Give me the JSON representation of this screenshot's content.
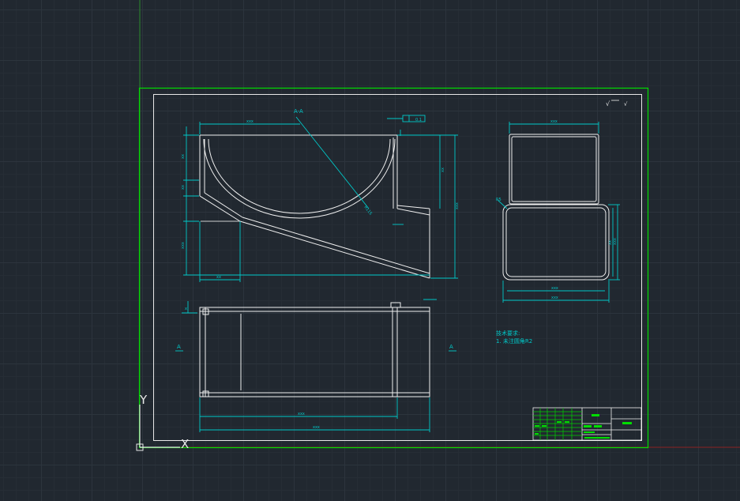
{
  "ucs": {
    "y_label": "Y",
    "x_label": "X"
  },
  "views": {
    "section_mark": "A-A",
    "section_arrow_left": "A",
    "section_arrow_right": "A",
    "roughness": "√",
    "tolerance_frame": "0.1"
  },
  "technical_notes": {
    "heading": "技术要求:",
    "item1": "1. 未注圆角R2"
  },
  "colors": {
    "background": "#212830",
    "drawing_border": "#00dd00",
    "geometry": "#f0f0f0",
    "dimension": "#00c8c8",
    "crosshair_x": "#cc2222",
    "crosshair_y": "#2c8a2c"
  }
}
